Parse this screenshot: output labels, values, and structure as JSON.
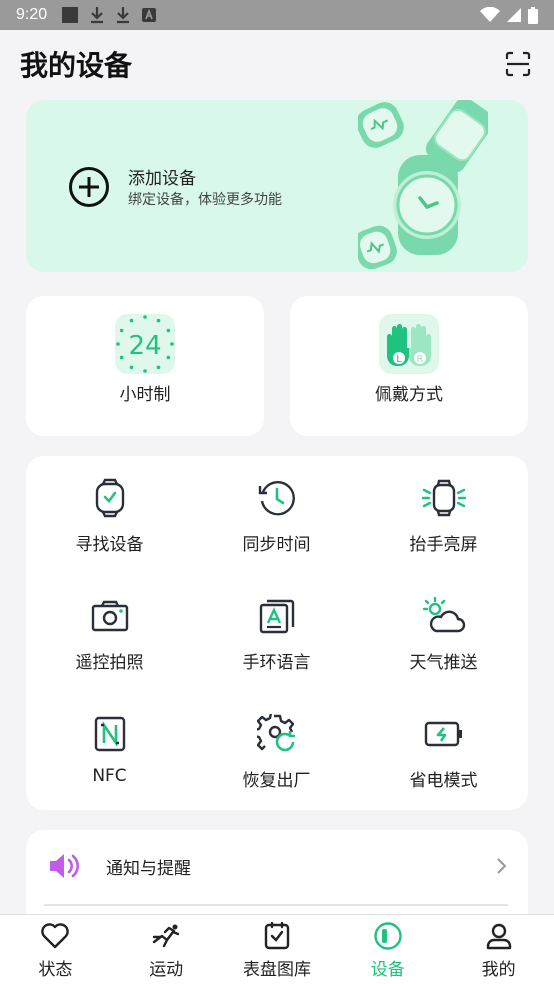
{
  "status_bar": {
    "time": "9:20"
  },
  "header": {
    "title": "我的设备"
  },
  "add_device": {
    "title": "添加设备",
    "subtitle": "绑定设备，体验更多功能"
  },
  "quick_cards": [
    {
      "label": "小时制",
      "badge": "24"
    },
    {
      "label": "佩戴方式",
      "left": "L",
      "right": "R"
    }
  ],
  "grid": [
    {
      "label": "寻找设备",
      "icon": "watch-icon"
    },
    {
      "label": "同步时间",
      "icon": "sync-time-icon"
    },
    {
      "label": "抬手亮屏",
      "icon": "raise-wake-icon"
    },
    {
      "label": "遥控拍照",
      "icon": "camera-icon"
    },
    {
      "label": "手环语言",
      "icon": "language-icon"
    },
    {
      "label": "天气推送",
      "icon": "weather-icon"
    },
    {
      "label": "NFC",
      "icon": "nfc-icon"
    },
    {
      "label": "恢复出厂",
      "icon": "factory-reset-icon"
    },
    {
      "label": "省电模式",
      "icon": "battery-saver-icon"
    }
  ],
  "notify": {
    "label": "通知与提醒"
  },
  "tabs": [
    {
      "label": "状态",
      "icon": "heart-icon"
    },
    {
      "label": "运动",
      "icon": "run-icon"
    },
    {
      "label": "表盘图库",
      "icon": "watchface-icon"
    },
    {
      "label": "设备",
      "icon": "device-icon",
      "active": true
    },
    {
      "label": "我的",
      "icon": "profile-icon"
    }
  ],
  "colors": {
    "accent": "#1fc27f",
    "card_green": "#d8f8e9",
    "purple": "#c05ce8",
    "icon_dark": "#2a2f3a"
  }
}
